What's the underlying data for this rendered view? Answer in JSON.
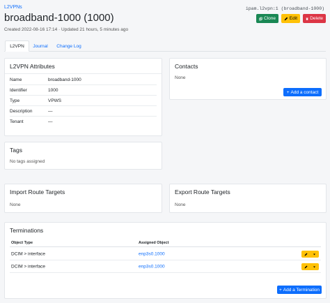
{
  "breadcrumb": "L2VPNs",
  "object_id": "ipam.l2vpn:1 (broadband-1000)",
  "title": "broadband-1000 (1000)",
  "created": "Created 2022-08-16 17:14 · Updated 21 hours, 5 minutes ago",
  "actions": {
    "clone": "Clone",
    "edit": "Edit",
    "delete": "Delete"
  },
  "tabs": [
    "L2VPN",
    "Journal",
    "Change Log"
  ],
  "attributes": {
    "title": "L2VPN Attributes",
    "rows": [
      {
        "key": "Name",
        "value": "broadband-1000"
      },
      {
        "key": "Identifier",
        "value": "1000"
      },
      {
        "key": "Type",
        "value": "VPWS"
      },
      {
        "key": "Description",
        "value": "—"
      },
      {
        "key": "Tenant",
        "value": "—"
      }
    ]
  },
  "contacts": {
    "title": "Contacts",
    "empty": "None",
    "add": "Add a contact"
  },
  "tags": {
    "title": "Tags",
    "empty": "No tags assigned"
  },
  "import_rt": {
    "title": "Import Route Targets",
    "empty": "None"
  },
  "export_rt": {
    "title": "Export Route Targets",
    "empty": "None"
  },
  "terminations": {
    "title": "Terminations",
    "columns": [
      "Object Type",
      "Assigned Object"
    ],
    "rows": [
      {
        "type": "DCIM > interface",
        "object": "enp3s0.1000"
      },
      {
        "type": "DCIM > interface",
        "object": "enp3s0.1000"
      }
    ],
    "add": "Add a Termination"
  },
  "colors": {
    "primary": "#0d6efd",
    "success": "#198754",
    "warning": "#ffc107",
    "danger": "#dc3545"
  }
}
